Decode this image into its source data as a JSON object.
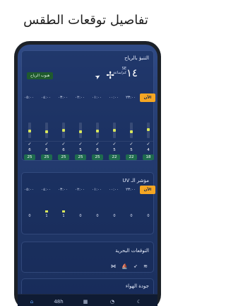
{
  "headline": "تفاصيل توقعات الطقس",
  "wind": {
    "title": "التنبؤ بالرياح",
    "speed": "١٤",
    "unit_line1": "SE",
    "unit_line2": "كم/ساعة",
    "gust_label": "هبوب الرياح",
    "times": [
      "الآن",
      "٢٣:٠٠",
      "٠٠:٠٠",
      "٠١:٠٠",
      "٠٢:٠٠",
      "٠٣:٠٠",
      "٠٤:٠٠",
      "٠٥:٠٠"
    ],
    "bar_levels": [
      0.45,
      0.3,
      0.4,
      0.35,
      0.3,
      0.4,
      0.3,
      0.35
    ],
    "speeds": [
      "4",
      "5",
      "5",
      "6",
      "5",
      "6",
      "6",
      "6"
    ],
    "gusts": [
      "18",
      "22",
      "22",
      "25",
      "25",
      "25",
      "25",
      "25"
    ]
  },
  "uv": {
    "title": "مؤشر الـ UV",
    "times": [
      "الآن",
      "٢٣:٠٠",
      "٠٠:٠٠",
      "٠١:٠٠",
      "٠٢:٠٠",
      "٠٣:٠٠",
      "٠٤:٠٠",
      "٠٥:٠٠"
    ],
    "values": [
      "0",
      "0",
      "0",
      "0",
      "0",
      "1",
      "1",
      "0"
    ]
  },
  "marine": {
    "title": "التوقعات البحرية"
  },
  "air": {
    "title": "جودة الهواء"
  },
  "nav": {
    "items": [
      {
        "label": "⌂",
        "icon": "home-icon"
      },
      {
        "label": "48h",
        "icon": "48h-icon"
      },
      {
        "label": "▦",
        "icon": "calendar-icon"
      },
      {
        "label": "◔",
        "icon": "radar-icon"
      },
      {
        "label": "☾",
        "icon": "moon-icon"
      }
    ]
  },
  "colors": {
    "accent": "#f5a623",
    "bar": "#d9e85b",
    "gust": "#1e6b4e",
    "screen": "#263e74"
  }
}
